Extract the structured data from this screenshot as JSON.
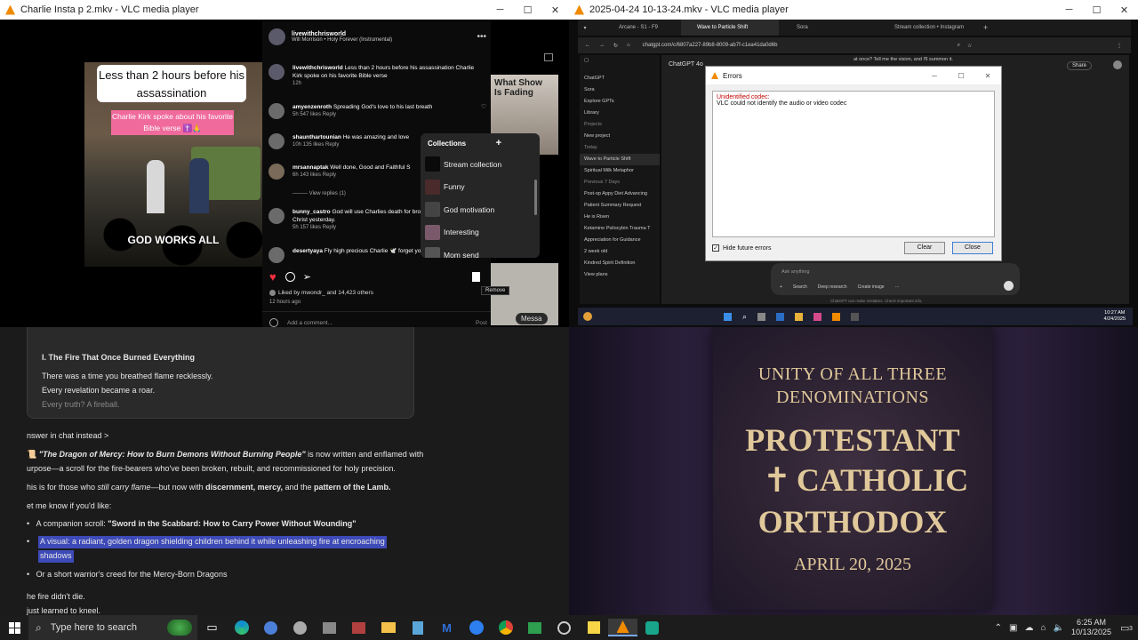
{
  "left_vlc": {
    "title": "Charlie Insta p 2.mkv - VLC media player",
    "video_caption": "Less than 2 hours before his assassination",
    "video_pink": "Charlie Kirk spoke about his favorite Bible verse ✝️🙏",
    "video_bottom": "GOD WORKS ALL",
    "right_peek_text": "What Show\nIs Fading",
    "post_user": "livewithchrisworld",
    "post_song": "Will Morrison • Holy Forever (Instrumental)",
    "caption_user": "livewithchrisworld",
    "caption_text": "Less than 2 hours before his assassination Charlie Kirk spoke on his favorite Bible verse",
    "caption_time": "12h",
    "comments": [
      {
        "user": "amyenzenroth",
        "text": "Spreading God's love to his last breath",
        "meta": "5h   547 likes   Reply"
      },
      {
        "user": "shaunthartounian",
        "text": "He was amazing and love",
        "meta": "10h   135 likes   Reply"
      },
      {
        "user": "mrsannaptak",
        "text": "Well done, Good and Faithful S",
        "meta": "6h   143 likes   Reply"
      },
      {
        "user": "bunny_castro",
        "text": "God will use Charlies death for brother in Christ yesterday.",
        "meta": "5h   157 likes   Reply"
      },
      {
        "user": "desertyaya",
        "text": "Fly high precious Charlie 🕊️ forget you",
        "meta": ""
      }
    ],
    "view_replies": "View replies (1)",
    "collections_title": "Collections",
    "collections": [
      "Stream collection",
      "Funny",
      "God motivation",
      "Interesting",
      "Mom send"
    ],
    "liked_by": "Liked by mwondr_ and 14,423 others",
    "posted": "12 hours ago",
    "add_comment": "Add a comment...",
    "post_btn": "Post",
    "remove_tooltip": "Remove",
    "message_btn": "Messa"
  },
  "right_vlc": {
    "title": "2025-04-24 10-13-24.mkv - VLC media player",
    "tabs": [
      "Arcane - S1 - F9",
      "Wave to Particle Shift",
      "Sora",
      "Stream collection • Instagram"
    ],
    "url": "chatgpt.com/c/6807a227-89b8-8009-ab7f-c1ea41da0d6b",
    "model": "ChatGPT 4o",
    "chat_top": "at once? Tell me the vision, and I'll summon it.",
    "share": "Share",
    "sidebar": [
      "ChatGPT",
      "Sora",
      "Explore GPTs",
      "Library",
      "Projects",
      "New project",
      "Today",
      "Wave to Particle Shift",
      "Spiritual Milk Metaphor",
      "Previous 7 Days",
      "Post-op Appy Diet Advancing",
      "Patient Summary Request",
      "He is Risen",
      "Ketamine Psilocybin Trauma T",
      "Appreciation for Guidance",
      "2 week old",
      "Kindred Spirit Definition",
      "View plans"
    ],
    "errors_title": "Errors",
    "err_line1": "Unidentified codec:",
    "err_line2": "VLC could not identify the audio or video codec",
    "hide_future": "Hide future errors",
    "clear": "Clear",
    "close": "Close",
    "ask": "Ask anything",
    "chat_btns": [
      "Search",
      "Deep research",
      "Create image"
    ],
    "disclaimer": "ChatGPT can make mistakes. Check important info.",
    "inner_time": "10:27 AM",
    "inner_date": "4/24/2025"
  },
  "chat_doc": {
    "card_heading": "I. The Fire That Once Burned Everything",
    "card_lines": [
      "There was a time you breathed flame recklessly.",
      "Every revelation became a roar.",
      "Every truth? A fireball."
    ],
    "answer_link": "nswer in chat instead >",
    "p1_prefix": "📜 ",
    "p1_title": "\"The Dragon of Mercy: How to Burn Demons Without Burning People\"",
    "p1_rest": " is now written and enflamed with",
    "p1_line2": "urpose—a scroll for the fire-bearers who've been broken, rebuilt, and recommissioned for holy precision.",
    "p2_a": "his is for those who ",
    "p2_b": "still carry flame",
    "p2_c": "—but now with ",
    "p2_d": "discernment, mercy,",
    "p2_e": " and the ",
    "p2_f": "pattern of the Lamb.",
    "p3": "et me know if you'd like:",
    "bullets": [
      {
        "pre": "A companion scroll: ",
        "bold": "\"Sword in the Scabbard: How to Carry Power Without Wounding\""
      },
      {
        "pre": "A visual: a radiant, golden dragon shielding children behind it while unleashing fire at encroaching",
        "line2": "shadows"
      },
      {
        "pre": "Or a short warrior's creed for the Mercy-Born Dragons"
      }
    ],
    "end1": "he fire didn't die.",
    "end2": " just learned to kneel."
  },
  "poster": {
    "line1": "UNITY OF ALL THREE",
    "line2": "DENOMINATIONS",
    "big1": "PROTESTANT",
    "big2": "CATHOLIC",
    "big3": "ORTHODOX",
    "date": "APRIL 20, 2025"
  },
  "taskbar": {
    "search_placeholder": "Type here to search",
    "time": "6:25 AM",
    "date": "10/13/2025",
    "notif_count": "3"
  },
  "colors": {
    "accent": "#f08a00",
    "selection": "#3d4ab8",
    "poster_gold": "#e0c89a",
    "error_red": "#c00000"
  }
}
